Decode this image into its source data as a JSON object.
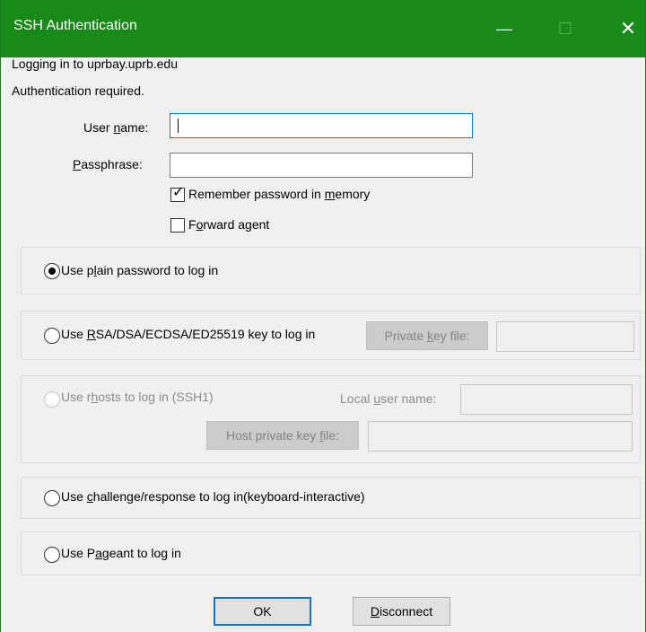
{
  "window": {
    "title": "SSH Authentication",
    "minimize_glyph": "—",
    "maximize_glyph": "☐",
    "close_glyph": "✕",
    "titlebar_color": "#188a18"
  },
  "status": {
    "login_line": "Logging in to uprbay.uprb.edu",
    "auth_line": "Authentication required."
  },
  "form": {
    "username_label_pre": "User ",
    "username_label_u": "n",
    "username_label_post": "ame:",
    "username_value": "",
    "passphrase_label_u": "P",
    "passphrase_label_post": "assphrase:",
    "passphrase_value": "",
    "remember": {
      "label_pre": "Remember password in ",
      "label_u": "m",
      "label_post": "emory",
      "checked": true
    },
    "forward": {
      "label_pre": "F",
      "label_u": "o",
      "label_post": "rward agent",
      "checked": false
    }
  },
  "methods": {
    "plain": {
      "label_pre": "Use p",
      "label_u": "l",
      "label_post": "ain password to log in",
      "selected": true
    },
    "rsa": {
      "label_pre": "Use ",
      "label_u": "R",
      "label_post": "SA/DSA/ECDSA/ED25519 key to log in",
      "selected": false,
      "key_button_pre": "Private ",
      "key_button_u": "k",
      "key_button_post": "ey file:",
      "key_value": ""
    },
    "rhosts": {
      "label_pre": "Use r",
      "label_u": "h",
      "label_post": "osts to log in (SSH1)",
      "selected": false,
      "local_user_pre": "Local ",
      "local_user_u": "u",
      "local_user_post": "ser name:",
      "host_key_pre": "Host private key ",
      "host_key_u": "f",
      "host_key_post": "ile:"
    },
    "challenge": {
      "label_pre": "Use ",
      "label_u": "c",
      "label_post": "hallenge/response to log in(keyboard-interactive)",
      "selected": false
    },
    "pageant": {
      "label_pre": "Use P",
      "label_u": "a",
      "label_post": "geant to log in",
      "selected": false
    }
  },
  "buttons": {
    "ok": "OK",
    "disconnect_u": "D",
    "disconnect_post": "isconnect"
  }
}
